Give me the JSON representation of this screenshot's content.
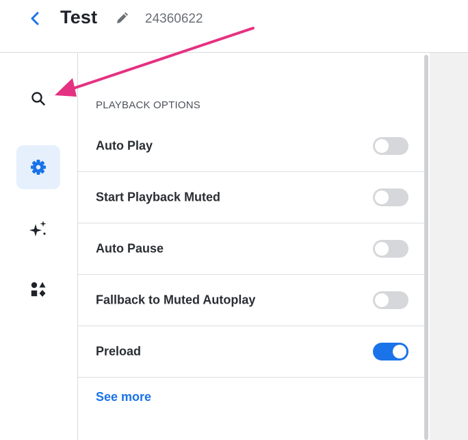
{
  "header": {
    "title": "Test",
    "project_id": "24360622",
    "back_icon": "chevron-left-icon",
    "edit_icon": "pencil-icon"
  },
  "rail": {
    "items": [
      {
        "name": "search",
        "icon": "search-icon",
        "active": false
      },
      {
        "name": "settings",
        "icon": "gear-icon",
        "active": true
      },
      {
        "name": "ai",
        "icon": "sparkles-icon",
        "active": false
      },
      {
        "name": "shapes",
        "icon": "shapes-icon",
        "active": false
      }
    ]
  },
  "panel": {
    "section_title": "PLAYBACK OPTIONS",
    "options": [
      {
        "label": "Auto Play",
        "enabled": false
      },
      {
        "label": "Start Playback Muted",
        "enabled": false
      },
      {
        "label": "Auto Pause",
        "enabled": false
      },
      {
        "label": "Fallback to Muted Autoplay",
        "enabled": false
      },
      {
        "label": "Preload",
        "enabled": true
      }
    ],
    "see_more": "See more"
  },
  "colors": {
    "accent": "#1a73e8",
    "toggle_off": "#d5d7da",
    "active_rail_bg": "#e6f0fd",
    "annotation_arrow": "#e53181"
  }
}
